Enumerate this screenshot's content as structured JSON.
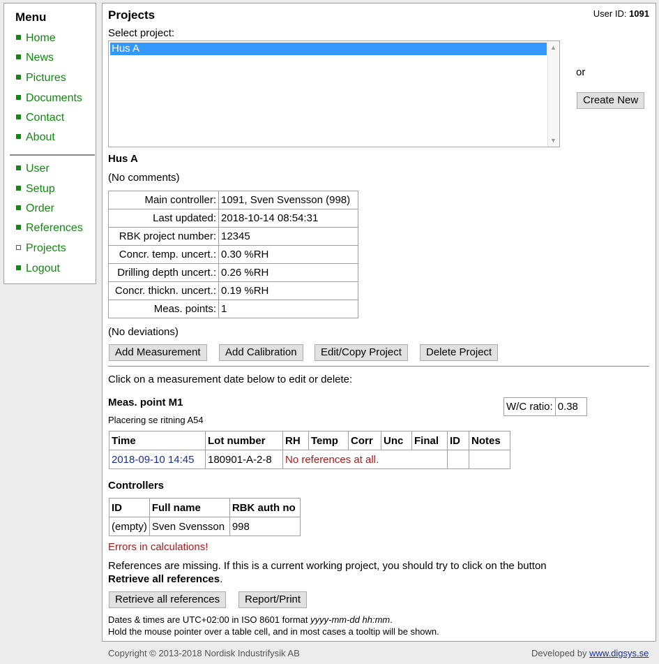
{
  "menu": {
    "title": "Menu",
    "items": [
      {
        "label": "Home"
      },
      {
        "label": "News"
      },
      {
        "label": "Pictures"
      },
      {
        "label": "Documents"
      },
      {
        "label": "Contact"
      },
      {
        "label": "About"
      },
      {
        "label": "User"
      },
      {
        "label": "Setup"
      },
      {
        "label": "Order"
      },
      {
        "label": "References"
      },
      {
        "label": "Projects"
      },
      {
        "label": "Logout"
      }
    ]
  },
  "header": {
    "title": "Projects",
    "user_id_label": "User ID:",
    "user_id": "1091"
  },
  "project_select": {
    "label": "Select project:",
    "options": [
      "Hus A"
    ],
    "or_text": "or",
    "create_new_label": "Create New"
  },
  "project": {
    "name": "Hus A",
    "comments": "(No comments)",
    "details": [
      {
        "key": "Main controller:",
        "value": "1091, Sven Svensson (998)"
      },
      {
        "key": "Last updated:",
        "value": "2018-10-14 08:54:31"
      },
      {
        "key": "RBK project number:",
        "value": "12345"
      },
      {
        "key": "Concr. temp. uncert.:",
        "value": "0.30 %RH"
      },
      {
        "key": "Drilling depth uncert.:",
        "value": "0.26 %RH"
      },
      {
        "key": "Concr. thickn. uncert.:",
        "value": "0.19 %RH"
      },
      {
        "key": "Meas. points:",
        "value": "1"
      }
    ],
    "deviations": "(No deviations)",
    "actions": {
      "add_measurement": "Add Measurement",
      "add_calibration": "Add Calibration",
      "edit_copy": "Edit/Copy Project",
      "delete": "Delete Project"
    }
  },
  "measurements": {
    "instruction": "Click on a measurement date below to edit or delete:",
    "point_title": "Meas. point M1",
    "point_note": "Placering se ritning A54",
    "wc_label": "W/C ratio:",
    "wc_value": "0.38",
    "columns": [
      "Time",
      "Lot number",
      "RH",
      "Temp",
      "Corr",
      "Unc",
      "Final",
      "ID",
      "Notes"
    ],
    "rows": [
      {
        "time": "2018-09-10 14:45",
        "lot": "180901-A-2-8",
        "message": "No references at all.",
        "id": "",
        "notes": ""
      }
    ]
  },
  "controllers": {
    "title": "Controllers",
    "columns": [
      "ID",
      "Full name",
      "RBK auth no"
    ],
    "rows": [
      {
        "id": "(empty)",
        "name": "Sven Svensson",
        "auth": "998"
      }
    ]
  },
  "errors": {
    "heading": "Errors in calculations!",
    "message": "References are missing. If this is a current working project, you should try to click on the button",
    "message_bold": "Retrieve all references",
    "message_end": "."
  },
  "bottom_actions": {
    "retrieve": "Retrieve all references",
    "report": "Report/Print"
  },
  "notes": {
    "dates_prefix": "Dates & times are UTC+02:00 in ISO 8601 format ",
    "dates_format": "yyyy-mm-dd hh:mm",
    "dates_suffix": ".",
    "tooltip_hint": "Hold the mouse pointer over a table cell, and in most cases a tooltip will be shown."
  },
  "footer": {
    "copyright": "Copyright © 2013-2018 Nordisk Industrifysik AB",
    "developed_by": "Developed by ",
    "developer_link": "www.digsys.se"
  },
  "colors": {
    "menu_green": "#0f8a0f",
    "selection_blue": "#3399ff",
    "error_red": "#b01818",
    "link_blue": "#1a2f9a"
  }
}
